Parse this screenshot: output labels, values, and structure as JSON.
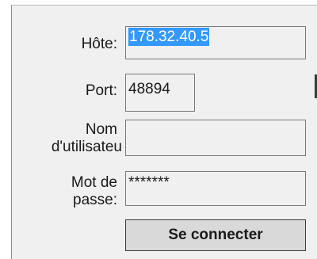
{
  "form": {
    "host_label": "Hôte:",
    "host_value": "178.32.40.5",
    "port_label": "Port:",
    "port_value": "48894",
    "username_label_line1": "Nom",
    "username_label_line2": "d'utilisateu",
    "username_value": "",
    "password_label_line1": "Mot de",
    "password_label_line2": "passe:",
    "password_value": "*******",
    "connect_button": "Se connecter"
  }
}
